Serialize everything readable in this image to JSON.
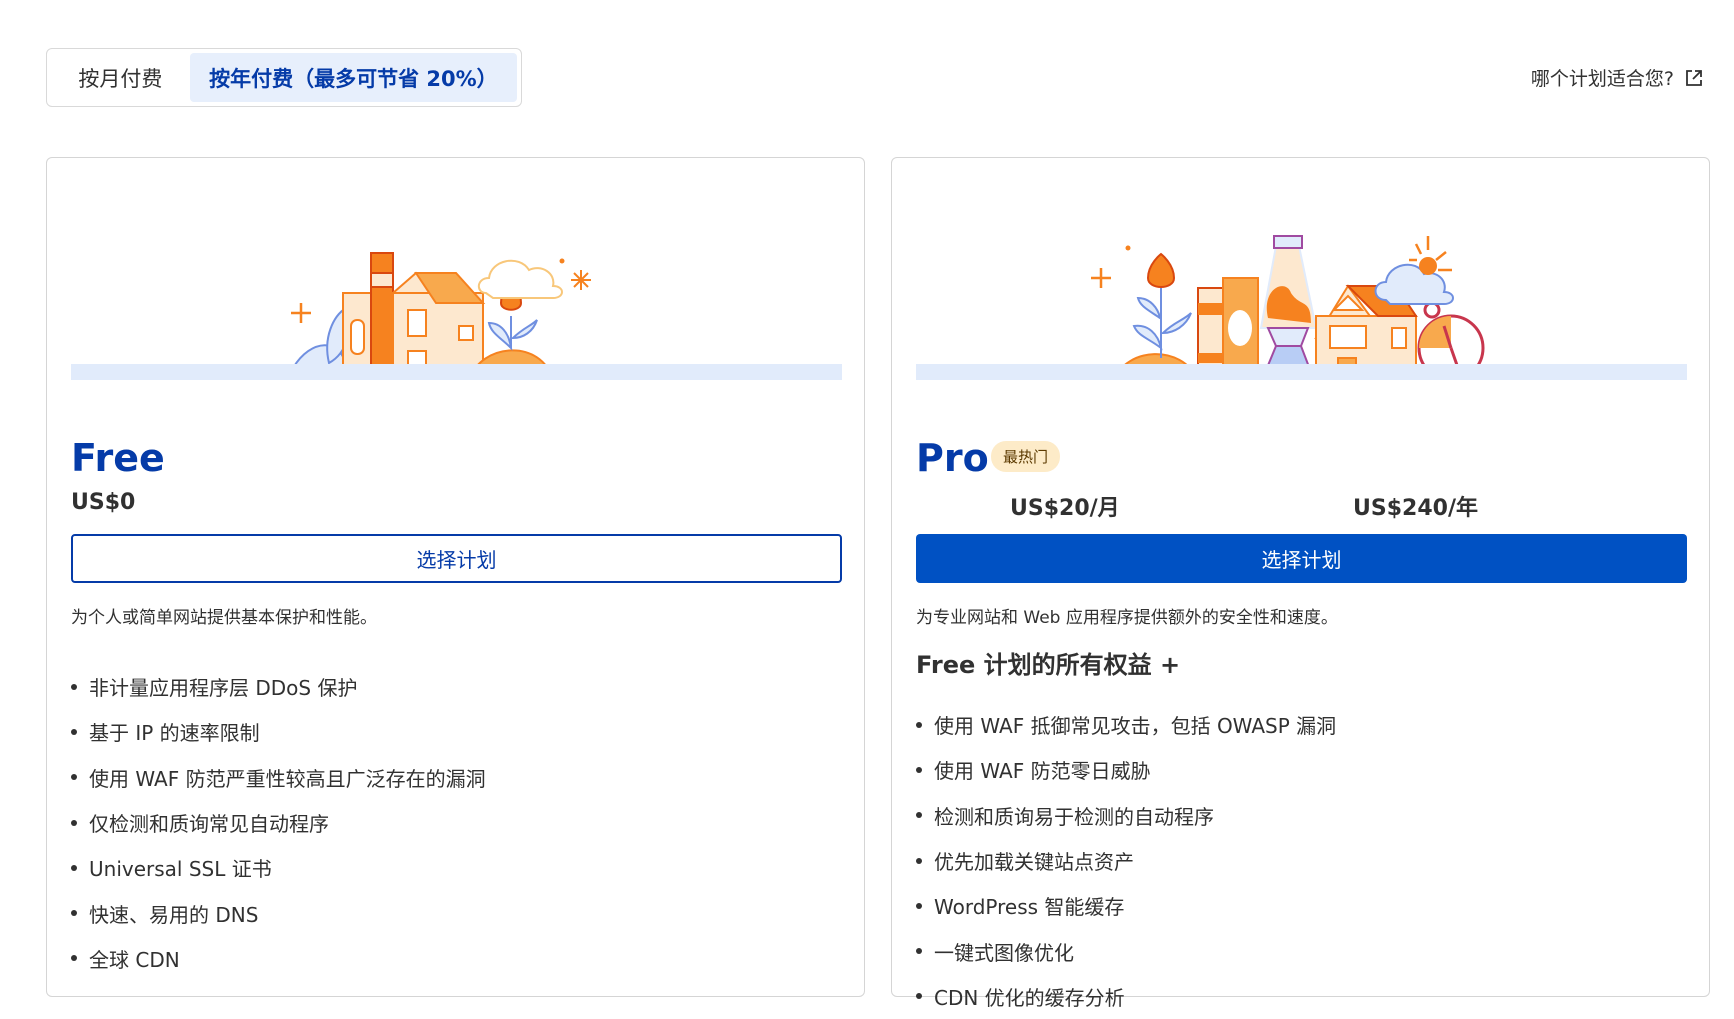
{
  "billing_toggle": {
    "monthly_label": "按月付费",
    "annual_label": "按年付费（最多可节省 20%）"
  },
  "help_link": {
    "label": "哪个计划适合您?",
    "icon": "external-link-icon"
  },
  "plans": [
    {
      "name": "Free",
      "price": "US$0",
      "button_label": "选择计划",
      "description": "为个人或简单网站提供基本保护和性能。",
      "features": [
        "非计量应用程序层 DDoS 保护",
        "基于 IP 的速率限制",
        "使用 WAF 防范严重性较高且广泛存在的漏洞",
        "仅检测和质询常见自动程序",
        "Universal SSL 证书",
        "快速、易用的 DNS",
        "全球 CDN"
      ]
    },
    {
      "name": "Pro",
      "badge": "最热门",
      "price_monthly": "US$20/月",
      "price_yearly": "US$240/年",
      "button_label": "选择计划",
      "description": "为专业网站和 Web 应用程序提供额外的安全性和速度。",
      "includes_heading": "Free 计划的所有权益 +",
      "features": [
        "使用 WAF 抵御常见攻击，包括 OWASP 漏洞",
        "使用 WAF 防范零日威胁",
        "检测和质询易于检测的自动程序",
        "优先加载关键站点资产",
        "WordPress 智能缓存",
        "一键式图像优化",
        "CDN 优化的缓存分析"
      ]
    }
  ],
  "colors": {
    "brand_blue": "#053ba8",
    "button_blue": "#0051c3",
    "toggle_active_bg": "#e7effc",
    "badge_bg": "#fdebc8",
    "illustration_orange": "#f6821f"
  }
}
